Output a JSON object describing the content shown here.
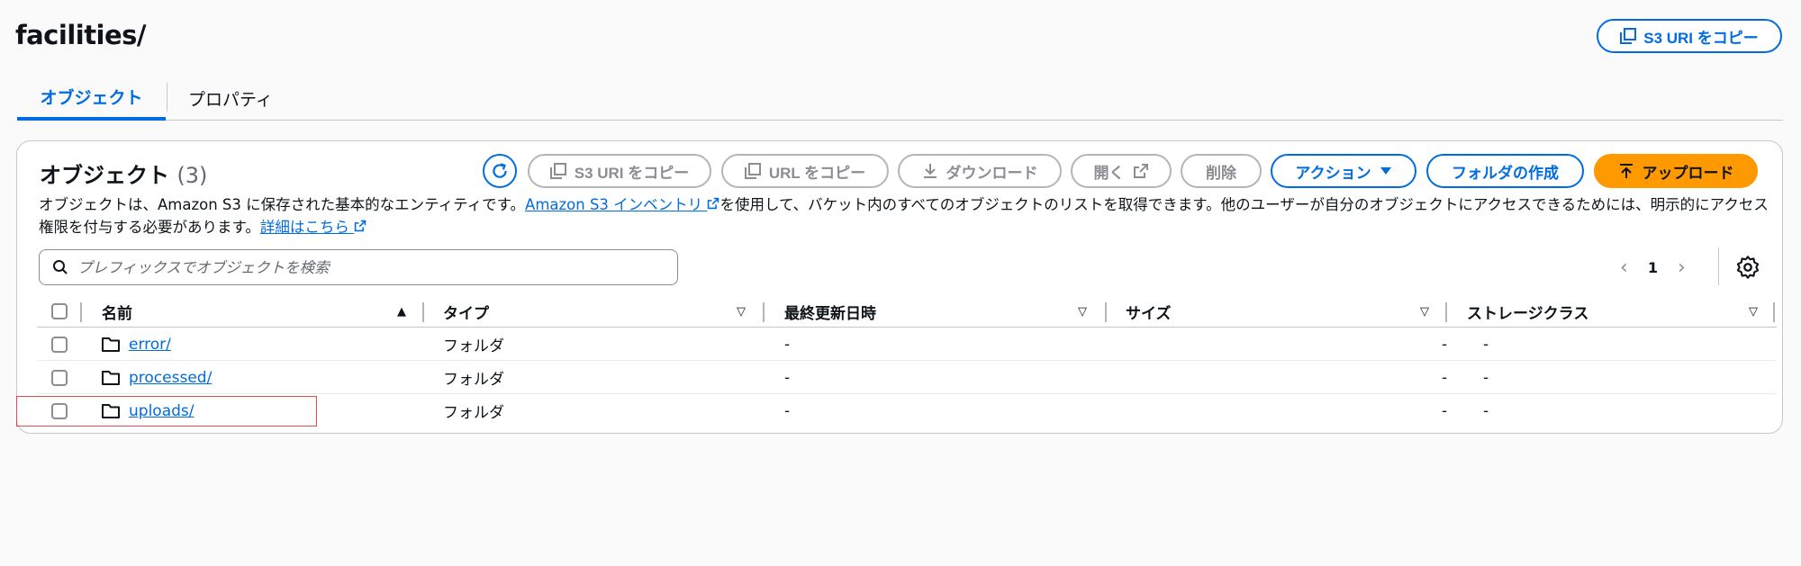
{
  "header": {
    "title": "facilities/",
    "copy_uri_label": "S3 URI をコピー"
  },
  "tabs": [
    {
      "label": "オブジェクト",
      "active": true
    },
    {
      "label": "プロパティ",
      "active": false
    }
  ],
  "panel": {
    "title": "オブジェクト",
    "count": "(3)",
    "toolbar": {
      "refresh_icon": "refresh-icon",
      "copy_s3_uri": "S3 URI をコピー",
      "copy_url": "URL をコピー",
      "download": "ダウンロード",
      "open": "開く",
      "delete": "削除",
      "actions": "アクション",
      "create_folder": "フォルダの作成",
      "upload": "アップロード"
    },
    "description": {
      "part1": "オブジェクトは、Amazon S3 に保存された基本的なエンティティです。",
      "inventory_link": "Amazon S3 インベントリ",
      "part2": "を使用して、バケット内のすべてのオブジェクトのリストを取得できます。他のユーザーが自分のオブジェクトにアクセスできるためには、明示的にアクセス権限を付与する必要があります。",
      "details_link": "詳細はこちら"
    },
    "search": {
      "placeholder": "プレフィックスでオブジェクトを検索",
      "value": ""
    },
    "pagination": {
      "current_page": "1"
    }
  },
  "table": {
    "columns": [
      "名前",
      "タイプ",
      "最終更新日時",
      "サイズ",
      "ストレージクラス"
    ],
    "sorted_column": "名前",
    "sort_direction": "ascending",
    "rows": [
      {
        "name": "error/",
        "type": "フォルダ",
        "last_modified": "-",
        "size": "-",
        "storage_class": "-"
      },
      {
        "name": "processed/",
        "type": "フォルダ",
        "last_modified": "-",
        "size": "-",
        "storage_class": "-"
      },
      {
        "name": "uploads/",
        "type": "フォルダ",
        "last_modified": "-",
        "size": "-",
        "storage_class": "-"
      }
    ]
  },
  "colors": {
    "accent": "#006ce0",
    "upload_button": "#ff9900",
    "highlight_box": "#e74c4c"
  }
}
